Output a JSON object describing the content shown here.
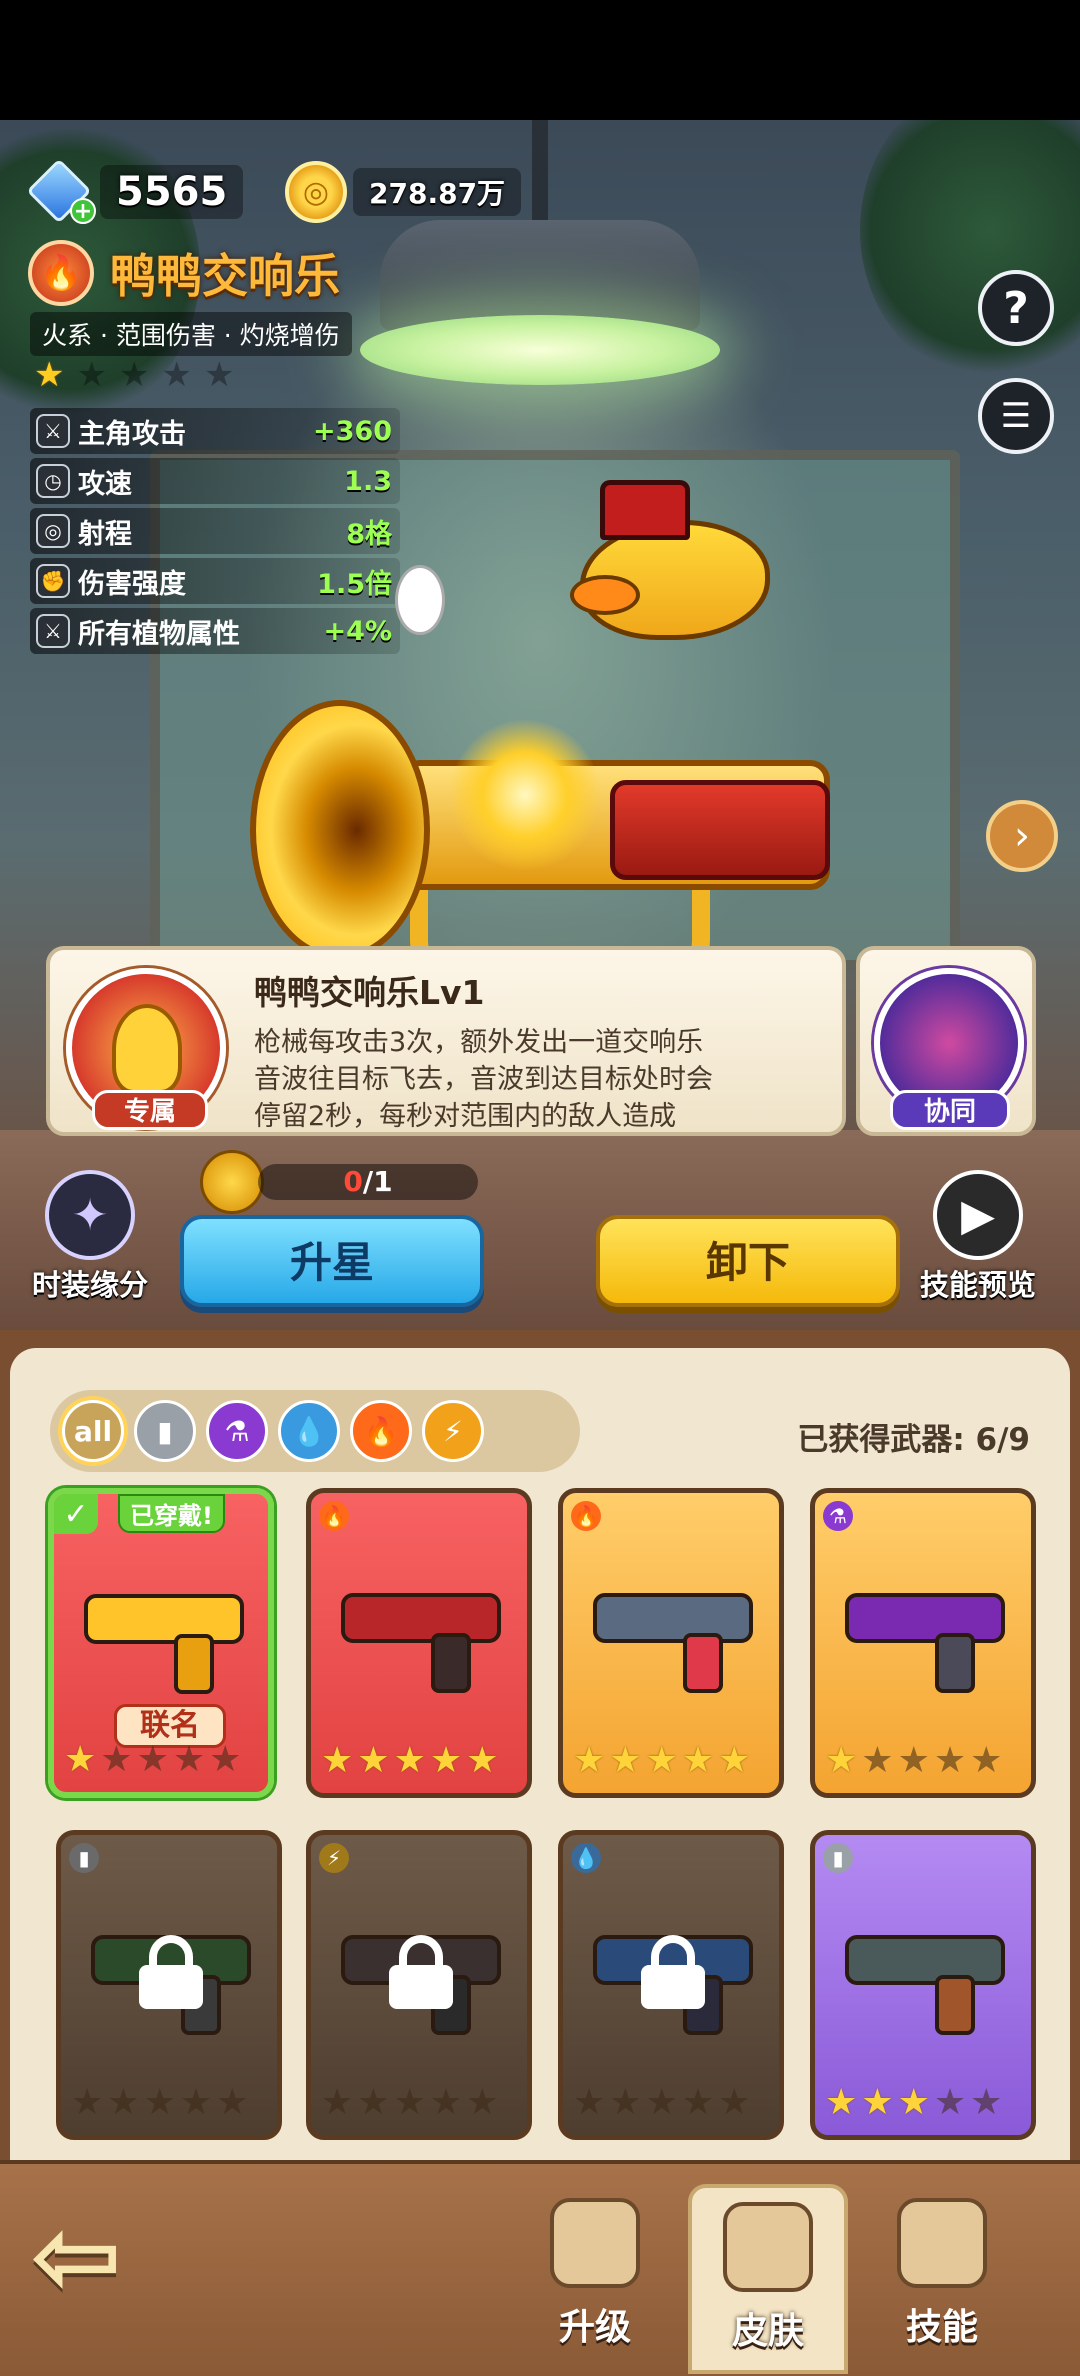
{
  "currency": {
    "gems": "5565",
    "coins": "278.87万"
  },
  "weapon": {
    "name": "鸭鸭交响乐",
    "tags": "火系 · 范围伤害 · 灼烧增伤",
    "stars": {
      "filled": 1,
      "total": 5
    },
    "stats": [
      {
        "label": "主角攻击",
        "value": "+360",
        "icon": "sword-icon"
      },
      {
        "label": "攻速",
        "value": "1.3",
        "icon": "clock-icon"
      },
      {
        "label": "射程",
        "value": "8格",
        "icon": "target-icon"
      },
      {
        "label": "伤害强度",
        "value": "1.5倍",
        "icon": "fist-icon"
      },
      {
        "label": "所有植物属性",
        "value": "+4%",
        "icon": "sword-icon"
      }
    ]
  },
  "skill": {
    "name": "鸭鸭交响乐Lv1",
    "desc_lines": [
      "枪械每攻击3次，额外发出一道交响乐",
      "音波往目标飞去，音波到达目标处时会",
      "停留2秒，每秒对范围内的敌人造成"
    ],
    "badge": "专属",
    "coop_badge": "协同"
  },
  "fragments": {
    "current": "0",
    "total": "/1"
  },
  "actions": {
    "skin_bond": "时装缘分",
    "upgrade_star": "升星",
    "unequip": "卸下",
    "skill_preview": "技能预览"
  },
  "inventory": {
    "filters": [
      "all",
      "gun",
      "poison",
      "water",
      "fire",
      "electric"
    ],
    "filter_all_label": "all",
    "owned_label": "已获得武器: 6/9",
    "equipped_tag": "已穿戴!",
    "collab_tag": "联名",
    "cards": [
      {
        "color": "red",
        "element": "fire",
        "stars": 1,
        "locked": false,
        "equipped": true,
        "collab": true
      },
      {
        "color": "red",
        "element": "fire",
        "stars": 5,
        "locked": false
      },
      {
        "color": "orange",
        "element": "fire",
        "stars": 5,
        "locked": false
      },
      {
        "color": "orange",
        "element": "poison",
        "stars": 1,
        "locked": false
      },
      {
        "color": "locked",
        "element": "gun",
        "stars": 0,
        "locked": true
      },
      {
        "color": "locked",
        "element": "electric",
        "stars": 0,
        "locked": true
      },
      {
        "color": "locked",
        "element": "water",
        "stars": 0,
        "locked": true
      },
      {
        "color": "purple",
        "element": "gun",
        "stars": 3,
        "locked": false
      }
    ]
  },
  "nav": {
    "back": "back-arrow-icon",
    "tabs": [
      {
        "label": "升级",
        "active": false
      },
      {
        "label": "皮肤",
        "active": true
      },
      {
        "label": "技能",
        "active": false
      }
    ]
  }
}
